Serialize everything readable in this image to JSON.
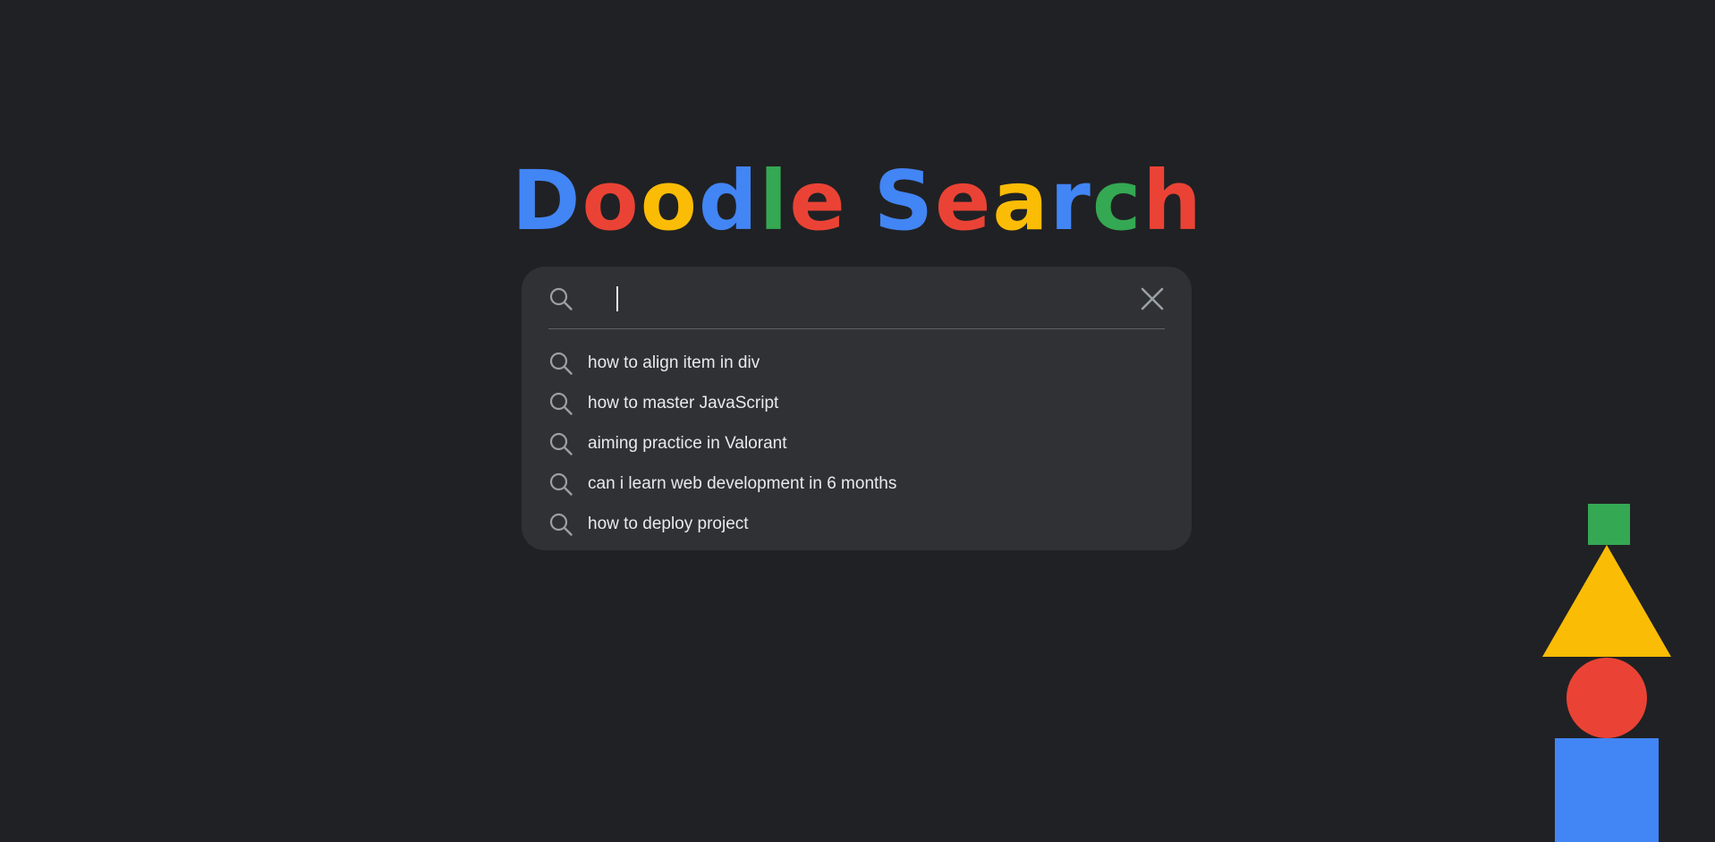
{
  "logo": {
    "letters": [
      {
        "char": "D",
        "color": "#4285f4"
      },
      {
        "char": "o",
        "color": "#ea4335"
      },
      {
        "char": "o",
        "color": "#fbbc05"
      },
      {
        "char": "d",
        "color": "#4285f4"
      },
      {
        "char": "l",
        "color": "#34a853"
      },
      {
        "char": "e",
        "color": "#ea4335"
      },
      {
        "char": "S",
        "color": "#4285f4"
      },
      {
        "char": "e",
        "color": "#ea4335"
      },
      {
        "char": "a",
        "color": "#fbbc05"
      },
      {
        "char": "r",
        "color": "#4285f4"
      },
      {
        "char": "c",
        "color": "#34a853"
      },
      {
        "char": "h",
        "color": "#ea4335"
      }
    ]
  },
  "search": {
    "value": "",
    "placeholder": "",
    "icon": "search-icon",
    "clear_icon": "close-icon",
    "suggestions": [
      {
        "label": "how to align item in div",
        "icon": "search-icon"
      },
      {
        "label": "how to master JavaScript",
        "icon": "search-icon"
      },
      {
        "label": "aiming practice in Valorant",
        "icon": "search-icon"
      },
      {
        "label": "can i learn web development in 6 months",
        "icon": "search-icon"
      },
      {
        "label": "how to deploy project",
        "icon": "search-icon"
      }
    ]
  },
  "colors": {
    "background": "#202124",
    "panel": "#303134",
    "text": "#e8eaed",
    "icon": "#9aa0a6",
    "blue": "#4285f4",
    "red": "#ea4335",
    "yellow": "#fbbc05",
    "green": "#34a853"
  }
}
